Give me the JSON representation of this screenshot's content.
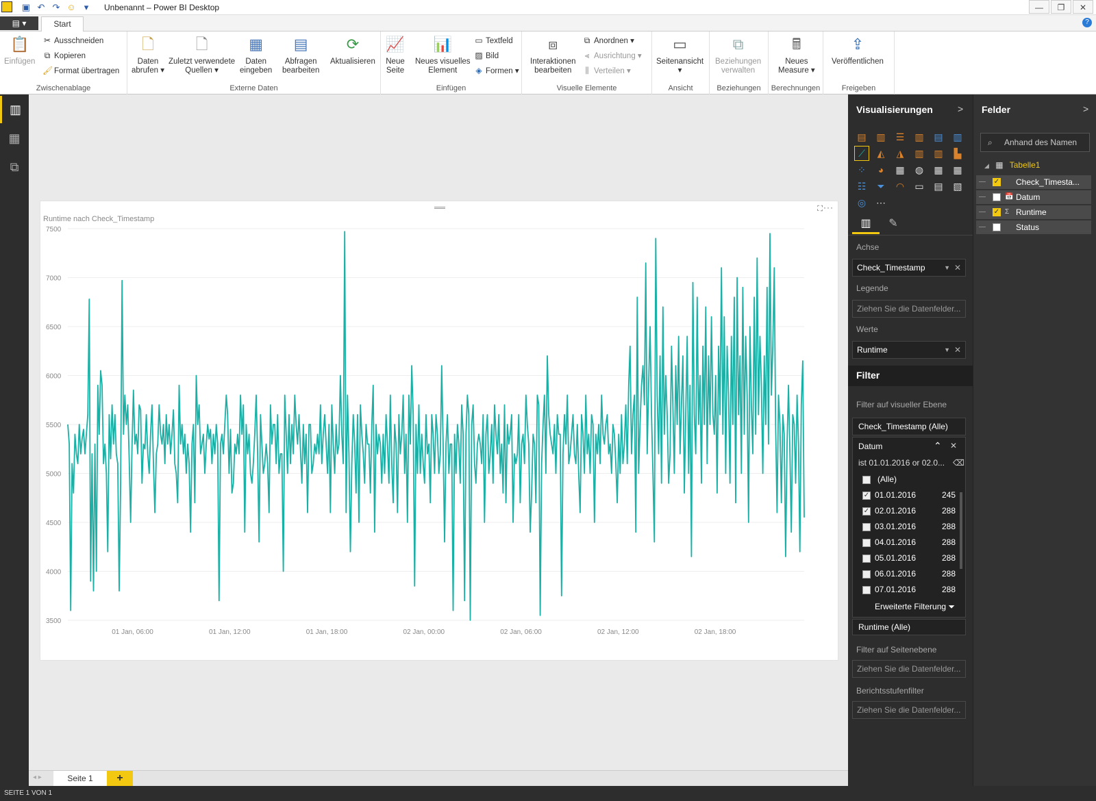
{
  "window": {
    "title": "Unbenannt – Power BI Desktop",
    "minimize": "—",
    "maximize": "❐",
    "close": "✕"
  },
  "ribbon_tabs": {
    "file": "▤ ▾",
    "start": "Start",
    "help": "?"
  },
  "ribbon": {
    "clipboard": {
      "label": "Zwischenablage",
      "paste": "Einfügen",
      "cut": "Ausschneiden",
      "copy": "Kopieren",
      "format_painter": "Format übertragen"
    },
    "external_data": {
      "label": "Externe Daten",
      "get_data_1": "Daten",
      "get_data_2": "abrufen ▾",
      "recent_1": "Zuletzt verwendete",
      "recent_2": "Quellen ▾",
      "enter_1": "Daten",
      "enter_2": "eingeben",
      "edit_1": "Abfragen",
      "edit_2": "bearbeiten",
      "refresh": "Aktualisieren"
    },
    "insert": {
      "label": "Einfügen",
      "new_page_1": "Neue",
      "new_page_2": "Seite",
      "new_visual_1": "Neues visuelles",
      "new_visual_2": "Element",
      "textbox": "Textfeld",
      "image": "Bild",
      "shapes": "Formen ▾"
    },
    "visual": {
      "label": "Visuelle Elemente",
      "interactions_1": "Interaktionen",
      "interactions_2": "bearbeiten",
      "arrange": "Anordnen ▾",
      "align": "Ausrichtung ▾",
      "distribute": "Verteilen ▾"
    },
    "view": {
      "label": "Ansicht",
      "page_view": "Seitenansicht",
      "page_view_2": "▾"
    },
    "relationships": {
      "label": "Beziehungen",
      "manage_1": "Beziehungen",
      "manage_2": "verwalten"
    },
    "calculations": {
      "label": "Berechnungen",
      "measure_1": "Neues",
      "measure_2": "Measure ▾"
    },
    "share": {
      "label": "Freigeben",
      "publish": "Veröffentlichen"
    }
  },
  "visual": {
    "title": "Runtime nach Check_Timestamp",
    "more": "···"
  },
  "chart_data": {
    "type": "line",
    "title": "Runtime nach Check_Timestamp",
    "xlabel": "",
    "ylabel": "",
    "ylim": [
      3500,
      7500
    ],
    "yticks": [
      "7500",
      "7000",
      "6500",
      "6000",
      "5500",
      "5000",
      "4500",
      "4000",
      "3500"
    ],
    "xticks": [
      "01 Jan, 06:00",
      "01 Jan, 12:00",
      "01 Jan, 18:00",
      "02 Jan, 00:00",
      "02 Jan, 06:00",
      "02 Jan, 12:00",
      "02 Jan, 18:00"
    ],
    "x_range_hours": [
      2,
      47.5
    ],
    "xtick_hours": [
      6,
      12,
      18,
      24,
      30,
      36,
      42
    ],
    "grid": true,
    "legend": "none",
    "color": "#1ab0a6",
    "series": [
      {
        "values": [
          5500,
          5300,
          3600,
          5100,
          4800,
          5400,
          5200,
          5100,
          5500,
          5200,
          5350,
          5450,
          5200,
          5400,
          5600,
          6780,
          3900,
          5200,
          3800,
          5300,
          4000,
          5900,
          5400,
          6050,
          5900,
          5100,
          5300,
          5000,
          4200,
          5600,
          5150,
          5700,
          5300,
          5600,
          5200,
          5100,
          3800,
          4900,
          6970,
          5400,
          5800,
          5500,
          5700,
          5150,
          4500,
          5300,
          5850,
          5300,
          5400,
          5200,
          5700,
          5650,
          4900,
          5300,
          5250,
          5600,
          5200,
          5000,
          5400,
          5700,
          5100,
          4600,
          5200,
          5300,
          5700,
          5400,
          5300,
          5500,
          5100,
          5600,
          5300,
          5500,
          5200,
          5400,
          5650,
          5100,
          5000,
          4700,
          5900,
          5300,
          5500,
          5200,
          5400,
          5000,
          5300,
          5100,
          4400,
          5300,
          5500,
          4700,
          6000,
          5500,
          5700,
          5200,
          5300,
          5400,
          5000,
          5300,
          5500,
          5350,
          5450,
          5100,
          5400,
          5200,
          5500,
          5300,
          3700,
          5300,
          5400,
          5200,
          5500,
          5800,
          5600,
          5000,
          5450,
          4800,
          4900,
          5300,
          5200,
          5400,
          5200,
          5800,
          5400,
          5700,
          4400,
          5500,
          5200,
          5400,
          5000,
          4900,
          5100,
          5400,
          5800,
          5200,
          4300,
          5600,
          5300,
          5000,
          5100,
          5300,
          5100,
          4600,
          5700,
          5300,
          5500,
          5500,
          5100,
          5600,
          5000,
          5200,
          5200,
          4000,
          5800,
          5400,
          5000,
          5600,
          5100,
          5500,
          5200,
          5800,
          5500,
          5300,
          5600,
          5250,
          4900,
          5500,
          5100,
          5400,
          4600,
          5500,
          5500,
          5000,
          5100,
          5300,
          5200,
          5400,
          5200,
          5700,
          5100,
          5400,
          5600,
          5300,
          5000,
          5500,
          4600,
          5700,
          5300,
          5000,
          5500,
          5200,
          5300,
          6000,
          5400,
          5100,
          7470,
          4600,
          5800,
          5200,
          4200,
          5100,
          5600,
          5300,
          4800,
          5600,
          4500,
          5700,
          5400,
          5200,
          4900,
          5500,
          5300,
          5300,
          4800,
          5500,
          5900,
          4400,
          5500,
          5200,
          5400,
          5300,
          4900,
          5400,
          5000,
          5600,
          5300,
          4900,
          5800,
          5100,
          4700,
          5500,
          5300,
          4600,
          5600,
          5200,
          5400,
          5800,
          5000,
          5400,
          4500,
          5800,
          5300,
          6100,
          5600,
          3850,
          5500,
          5000,
          5700,
          5000,
          5400,
          5100,
          4900,
          5600,
          5200,
          5300,
          4700,
          5600,
          5400,
          5000,
          5600,
          5400,
          5000,
          5200,
          6100,
          5300,
          4300,
          5300,
          5600,
          5000,
          5300,
          5300,
          3600,
          5400,
          5000,
          5500,
          5300,
          4900,
          5700,
          5400,
          3700,
          5400,
          5800,
          5600,
          3500,
          5500,
          5700,
          5100,
          4900,
          5300,
          5400,
          5300,
          5100,
          5600,
          4500,
          5400,
          5600,
          5000,
          5200,
          5500,
          4900,
          5700,
          5400,
          5200,
          5600,
          5000,
          5300,
          4800,
          5700,
          4700,
          5500,
          5300,
          5400,
          5600,
          4500,
          5200,
          5100,
          5200,
          5600,
          4700,
          5300,
          5400,
          5100,
          5800,
          5500,
          5300,
          4400,
          4800,
          5400,
          5300,
          4700,
          5800,
          5700,
          3550,
          5100,
          5500,
          5800,
          5000,
          6200,
          5600,
          5400,
          5300,
          5200,
          5500,
          5000,
          5600,
          5400,
          5400,
          3750,
          5200,
          5600,
          5300,
          5800,
          5100,
          5200,
          5400,
          5600,
          5200,
          5100,
          5500,
          5000,
          4600,
          5600,
          5400,
          5000,
          5800,
          5200,
          5400,
          5000,
          5600,
          5500,
          4500,
          5400,
          5200,
          5500,
          5100,
          5800,
          5400,
          5300,
          5500,
          5600,
          5200,
          5300,
          5000,
          5500,
          5400,
          5100,
          4700,
          5400,
          5000,
          5600,
          5100,
          5300,
          5700,
          5100,
          5900,
          6300,
          5200,
          5600,
          5800,
          4400,
          6800,
          5000,
          5500,
          5900,
          6100,
          5700,
          7150,
          5200,
          5900,
          6500,
          5600,
          5000,
          4300,
          7400,
          5800,
          5200,
          6200,
          4900,
          6700,
          5400,
          6000,
          5600,
          4900,
          5200,
          6300,
          5700,
          5000,
          6100,
          5500,
          6400,
          5200,
          5700,
          6200,
          4800,
          5600,
          6400,
          5000,
          5900,
          4150,
          6950,
          5600,
          5200,
          6800,
          5500,
          6000,
          4900,
          6300,
          5500,
          6700,
          5100,
          6200,
          5500,
          6600,
          5600,
          5400,
          6000,
          4800,
          6300,
          5600,
          7100,
          5400,
          6600,
          5000,
          6300,
          5800,
          4900,
          6400,
          5500,
          6800,
          4700,
          7000,
          5600,
          6200,
          5000,
          6900,
          5400,
          6400,
          5800,
          4500,
          6500,
          5700,
          5200,
          6800,
          5400,
          7200,
          5600,
          6400,
          5900,
          5000,
          6200,
          5500,
          6900,
          5300,
          7450,
          5800,
          6300,
          7100,
          5500,
          4600,
          5800,
          5500,
          4700,
          5600,
          5400,
          4150,
          5300,
          5900,
          5200,
          4400,
          5600,
          5500,
          4900,
          5800,
          5300,
          4200,
          5700,
          6150,
          4550
        ]
      }
    ]
  },
  "pages": {
    "arrows": "◂ ▸",
    "page1": "Seite 1",
    "add": "+"
  },
  "statusbar": {
    "text": "SEITE 1 VON 1"
  },
  "viz_pane": {
    "header": "Visualisierungen",
    "chevron": ">",
    "axis_label": "Achse",
    "axis_value": "Check_Timestamp",
    "legend_label": "Legende",
    "legend_placeholder": "Ziehen Sie die Datenfelder...",
    "values_label": "Werte",
    "values_value": "Runtime",
    "filter_header": "Filter",
    "visual_level": "Filter auf visueller Ebene",
    "filter_timestamp": "Check_Timestamp (Alle)",
    "datum_label": "Datum",
    "datum_condition": "ist 01.01.2016 or 02.0...",
    "datum_items": [
      {
        "label": "(Alle)",
        "count": "",
        "checked": false
      },
      {
        "label": "01.01.2016",
        "count": "245",
        "checked": true
      },
      {
        "label": "02.01.2016",
        "count": "288",
        "checked": true
      },
      {
        "label": "03.01.2016",
        "count": "288",
        "checked": false
      },
      {
        "label": "04.01.2016",
        "count": "288",
        "checked": false
      },
      {
        "label": "05.01.2016",
        "count": "288",
        "checked": false
      },
      {
        "label": "06.01.2016",
        "count": "288",
        "checked": false
      },
      {
        "label": "07.01.2016",
        "count": "288",
        "checked": false
      }
    ],
    "advanced": "Erweiterte Filterung",
    "runtime_filter": "Runtime (Alle)",
    "page_level": "Filter auf Seitenebene",
    "page_placeholder": "Ziehen Sie die Datenfelder...",
    "report_level": "Berichtsstufenfilter",
    "report_placeholder": "Ziehen Sie die Datenfelder..."
  },
  "fields_pane": {
    "header": "Felder",
    "chevron": ">",
    "search_placeholder": "Anhand des Namen",
    "table": "Tabelle1",
    "fields": [
      {
        "name": "Check_Timesta...",
        "checked": true,
        "type": ""
      },
      {
        "name": "Datum",
        "checked": false,
        "type": "📅"
      },
      {
        "name": "Runtime",
        "checked": true,
        "type": "Σ"
      },
      {
        "name": "Status",
        "checked": false,
        "type": ""
      }
    ]
  }
}
